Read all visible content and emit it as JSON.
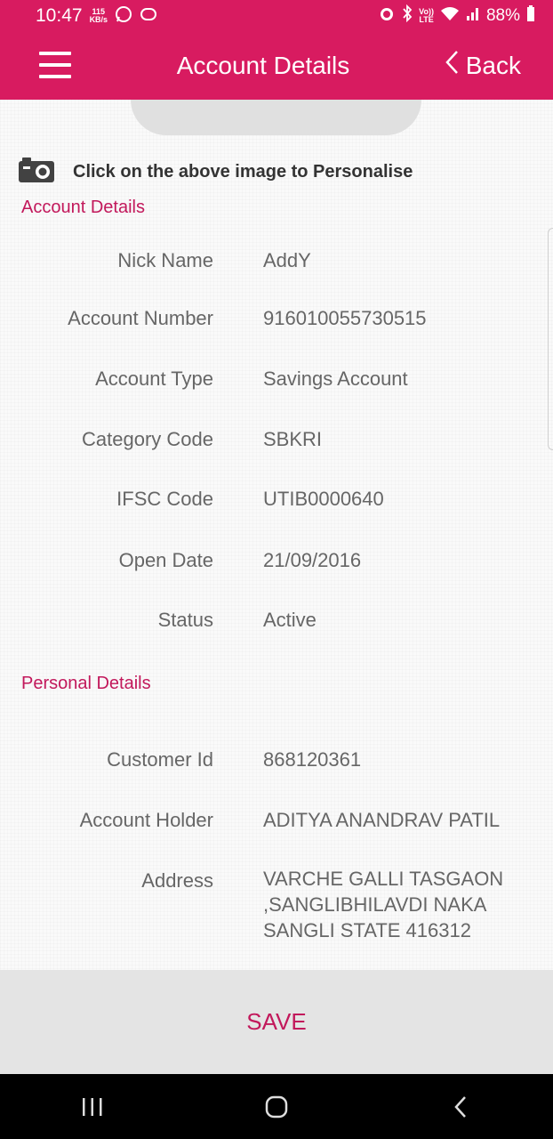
{
  "status_bar": {
    "time": "10:47",
    "speed_value": "115",
    "speed_unit": "KB/s",
    "volte": "Vo))",
    "lte": "LTE",
    "battery": "88%"
  },
  "app_bar": {
    "title": "Account Details",
    "back_label": "Back"
  },
  "personalise_hint": "Click on the above image to Personalise",
  "account_section": {
    "title": "Account Details",
    "fields": [
      {
        "label": "Nick Name",
        "value": "AddY"
      },
      {
        "label": "Account Number",
        "value": "916010055730515"
      },
      {
        "label": "Account Type",
        "value": "Savings Account"
      },
      {
        "label": "Category Code",
        "value": "SBKRI"
      },
      {
        "label": "IFSC Code",
        "value": "UTIB0000640"
      },
      {
        "label": "Open Date",
        "value": "21/09/2016"
      },
      {
        "label": "Status",
        "value": "Active"
      }
    ]
  },
  "personal_section": {
    "title": "Personal Details",
    "fields": [
      {
        "label": "Customer Id",
        "value": "868120361"
      },
      {
        "label": "Account Holder",
        "value": "ADITYA ANANDRAV PATIL"
      },
      {
        "label": "Address",
        "value": "VARCHE GALLI TASGAON ,SANGLIBHILAVDI NAKA SANGLI STATE 416312"
      }
    ]
  },
  "save_label": "SAVE",
  "icons": {
    "menu": "hamburger-menu-icon",
    "back": "chevron-left-icon",
    "camera": "camera-icon",
    "nav_recents": "recents-icon",
    "nav_home": "home-icon",
    "nav_back": "back-icon"
  },
  "colors": {
    "brand": "#d81b60",
    "section_title": "#c2185b",
    "text": "#666666"
  }
}
